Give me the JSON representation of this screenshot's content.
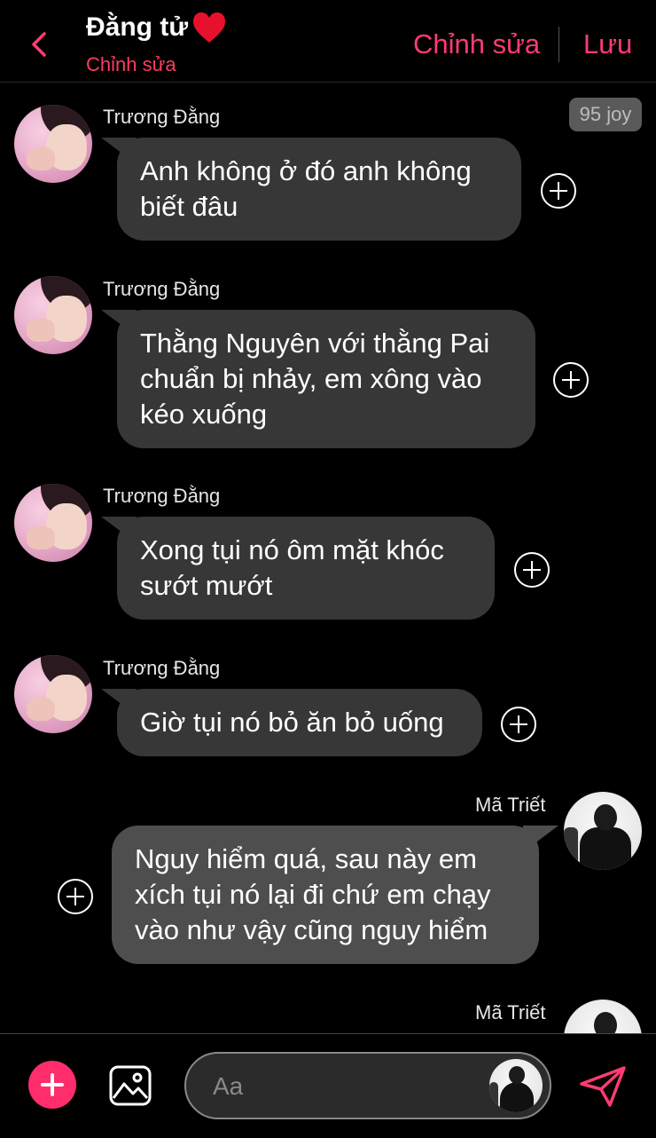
{
  "header": {
    "back_icon": "chevron-left-icon",
    "title": "Đằng tử",
    "title_icon": "red-heart-icon",
    "subtitle": "Chỉnh sửa",
    "edit_label": "Chỉnh sửa",
    "save_label": "Lưu",
    "accent_color": "#ff3b72"
  },
  "badge": {
    "text": "95 joy"
  },
  "messages": [
    {
      "sender": "Trương Đằng",
      "direction": "incoming",
      "text": "Anh không ở đó anh không\nbiết đâu"
    },
    {
      "sender": "Trương Đằng",
      "direction": "incoming",
      "text": "Thằng Nguyên với thằng Pai\nchuẩn bị nhảy, em xông vào\nkéo xuống"
    },
    {
      "sender": "Trương Đằng",
      "direction": "incoming",
      "text": "Xong tụi nó ôm mặt khóc\nsướt mướt"
    },
    {
      "sender": "Trương Đằng",
      "direction": "incoming",
      "text": "Giờ tụi nó bỏ ăn bỏ uống"
    },
    {
      "sender": "Mã Triết",
      "direction": "outgoing",
      "text": "Nguy hiểm quá, sau này em\nxích tụi nó lại đi chứ em chạy\nvào như vậy cũng nguy hiểm"
    },
    {
      "sender": "Mã Triết",
      "direction": "outgoing",
      "text": ""
    }
  ],
  "composer": {
    "placeholder": "Aa",
    "add_icon": "plus-icon",
    "image_icon": "image-icon",
    "send_icon": "send-icon",
    "add_color": "#ff2d6b"
  }
}
